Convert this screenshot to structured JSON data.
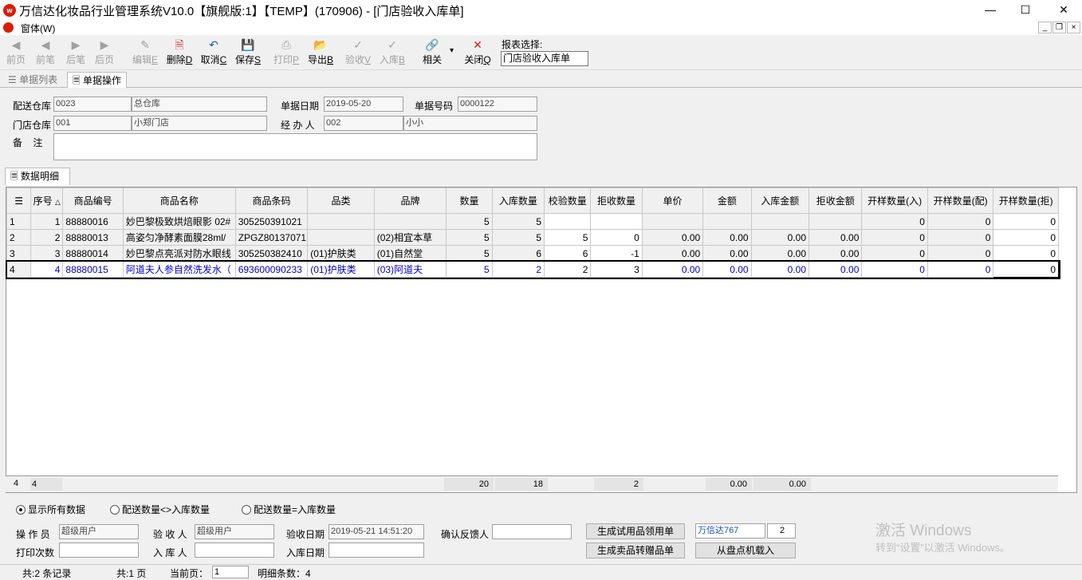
{
  "window": {
    "title": "万信达化妆品行业管理系统V10.0【旗舰版:1】【TEMP】(170906) - [门店验收入库单]",
    "logo_text": "w",
    "min": "—",
    "max": "☐",
    "close": "✕"
  },
  "menu": {
    "label": "窗体(W)"
  },
  "toolbar": {
    "buttons": [
      {
        "label": "前页",
        "icon": "◀"
      },
      {
        "label": "前笔",
        "icon": "◀"
      },
      {
        "label": "后笔",
        "icon": "▶"
      },
      {
        "label": "后页",
        "icon": "▶"
      },
      {
        "label": "编辑",
        "key": "E",
        "icon": "✎"
      },
      {
        "label": "删除",
        "key": "D",
        "icon": "🗎"
      },
      {
        "label": "取消",
        "key": "C",
        "icon": "↶"
      },
      {
        "label": "保存",
        "key": "S",
        "icon": "💾"
      },
      {
        "label": "打印",
        "key": "P",
        "icon": "⎙"
      },
      {
        "label": "导出",
        "key": "B",
        "icon": "📂"
      },
      {
        "label": "验收",
        "key": "V",
        "icon": "✓"
      },
      {
        "label": "入库",
        "key": "B",
        "icon": "✓"
      },
      {
        "label": "相关",
        "icon": "🔗"
      },
      {
        "label": "关闭",
        "key": "Q",
        "icon": "✕"
      }
    ],
    "dropdown_arrow": "▾",
    "report_label": "报表选择:",
    "report_value": "门店验收入库单"
  },
  "tabs": {
    "list": "单据列表",
    "ops": "单据操作"
  },
  "header_form": {
    "ship_wh_label": "配送仓库",
    "ship_wh_code": "0023",
    "ship_wh_name": "总仓库",
    "doc_date_label": "单据日期",
    "doc_date": "2019-05-20",
    "doc_no_label": "单据号码",
    "doc_no": "0000122",
    "store_wh_label": "门店仓库",
    "store_wh_code": "001",
    "store_wh_name": "小郑门店",
    "handler_label": "经 办 人",
    "handler_code": "002",
    "handler_name": "小小",
    "remark_label": "备    注",
    "remark": ""
  },
  "detail_tab": "数据明细",
  "grid": {
    "columns": [
      "序号",
      "商品编号",
      "商品名称",
      "商品条码",
      "品类",
      "品牌",
      "数量",
      "入库数量",
      "校验数量",
      "拒收数量",
      "单价",
      "金额",
      "入库金额",
      "拒收金额",
      "开样数量(入)",
      "开样数量(配)",
      "开样数量(拒)"
    ],
    "sort_icon": "△",
    "rows": [
      {
        "idx": "1",
        "seq": "1",
        "code": "88880016",
        "name": "妙巴黎极致烘焙眼影 02#",
        "barcode": "305250391021",
        "cat": "",
        "brand": "",
        "qty": "5",
        "in_qty": "5",
        "chk_qty": "",
        "rej_qty": "",
        "price": "",
        "amt": "",
        "in_amt": "",
        "rej_amt": "",
        "s_in": "0",
        "s_dist": "0",
        "s_rej": "0"
      },
      {
        "idx": "2",
        "seq": "2",
        "code": "88880013",
        "name": "高姿匀净酵素面膜28ml/",
        "barcode": "ZPGZ80137071",
        "cat": "",
        "brand": "(02)相宜本草",
        "qty": "5",
        "in_qty": "5",
        "chk_qty": "5",
        "rej_qty": "0",
        "price": "0.00",
        "amt": "0.00",
        "in_amt": "0.00",
        "rej_amt": "0.00",
        "s_in": "0",
        "s_dist": "0",
        "s_rej": "0"
      },
      {
        "idx": "3",
        "seq": "3",
        "code": "88880014",
        "name": "妙巴黎点亮派对防水眼线",
        "barcode": "305250382410",
        "cat": "(01)护肤类",
        "brand": "(01)自然堂",
        "qty": "5",
        "in_qty": "6",
        "chk_qty": "6",
        "rej_qty": "-1",
        "price": "0.00",
        "amt": "0.00",
        "in_amt": "0.00",
        "rej_amt": "0.00",
        "s_in": "0",
        "s_dist": "0",
        "s_rej": "0"
      },
      {
        "idx": "4",
        "seq": "4",
        "code": "88880015",
        "name": "阿道夫人参自然洗发水（",
        "barcode": "693600090233",
        "cat": "(01)护肤类",
        "brand": "(03)阿道夫",
        "qty": "5",
        "in_qty": "2",
        "chk_qty": "2",
        "rej_qty": "3",
        "price": "0.00",
        "amt": "0.00",
        "in_amt": "0.00",
        "rej_amt": "0.00",
        "s_in": "0",
        "s_dist": "0",
        "s_rej": "0"
      }
    ],
    "footer": {
      "count": "4",
      "count2": "4",
      "qty": "20",
      "in_qty": "18",
      "rej_qty": "2",
      "amt": "0.00",
      "in_amt": "0.00"
    }
  },
  "filters": {
    "all": "显示所有数据",
    "neq": "配送数量<>入库数量",
    "eq": "配送数量=入库数量"
  },
  "bottom_form": {
    "operator_label": "操 作 员",
    "operator": "超级用户",
    "acceptor_label": "验 收 人",
    "acceptor": "超级用户",
    "accept_date_label": "验收日期",
    "accept_date": "2019-05-21 14:51:20",
    "feedback_label": "确认反馈人",
    "feedback": "",
    "print_label": "打印次数",
    "print_count": "",
    "storer_label": "入 库 人",
    "storer": "",
    "store_date_label": "入库日期",
    "store_date": "",
    "btn_trial": "生成试用品领用单",
    "btn_gift": "生成卖品转赠品单",
    "btn_import": "从盘点机载入",
    "link_name": "万信达767",
    "link_num": "2"
  },
  "watermark": {
    "line1": "激活 Windows",
    "line2": "转到“设置”以激活 Windows。"
  },
  "status": {
    "records": "共:2 条记录",
    "pages": "共:1 页",
    "cur_label": "当前页：",
    "cur_page": "1",
    "detail": "明细条数：4"
  }
}
